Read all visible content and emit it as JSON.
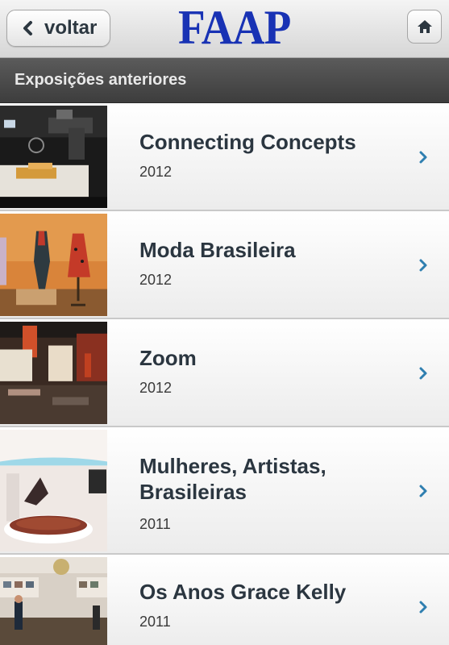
{
  "topbar": {
    "back_label": "voltar",
    "logo_text": "FAAP"
  },
  "section": {
    "title": "Exposições anteriores"
  },
  "exhibitions": [
    {
      "title": "Connecting Concepts",
      "year": "2012"
    },
    {
      "title": "Moda Brasileira",
      "year": "2012"
    },
    {
      "title": "Zoom",
      "year": "2012"
    },
    {
      "title": "Mulheres, Artistas, Brasileiras",
      "year": "2011"
    },
    {
      "title": "Os Anos Grace Kelly",
      "year": "2011"
    }
  ],
  "colors": {
    "logo": "#1832b4",
    "chevron": "#2f7fb0",
    "title_text": "#2b3640",
    "section_header": "#4a4a4a"
  }
}
